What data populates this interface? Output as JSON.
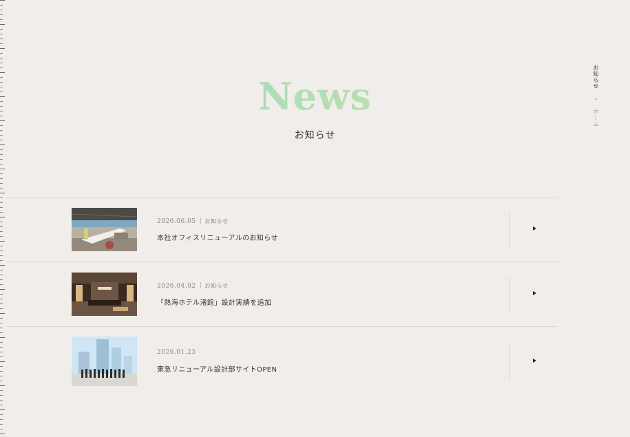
{
  "hero": {
    "title": "News",
    "subtitle": "お知らせ"
  },
  "breadcrumb": {
    "current": "お知らせ",
    "separator": "・",
    "home": "ホーム"
  },
  "news": [
    {
      "date": "2026.06.05",
      "category": "お知らせ",
      "title": "本社オフィスリニューアルのお知らせ",
      "thumb_icon": "office-photo"
    },
    {
      "date": "2026.04.02",
      "category": "お知らせ",
      "title": "「熱海ホテル渚館」設計実績を追加",
      "thumb_icon": "hotel-lobby-photo"
    },
    {
      "date": "2026.01.23",
      "category": "",
      "title": "東急リニューアル設計部サイトOPEN",
      "thumb_icon": "team-rooftop-photo"
    }
  ],
  "colors": {
    "background": "#f1edea",
    "title_gradient_start": "#8fd8d0",
    "title_gradient_end": "#cfe08a"
  }
}
